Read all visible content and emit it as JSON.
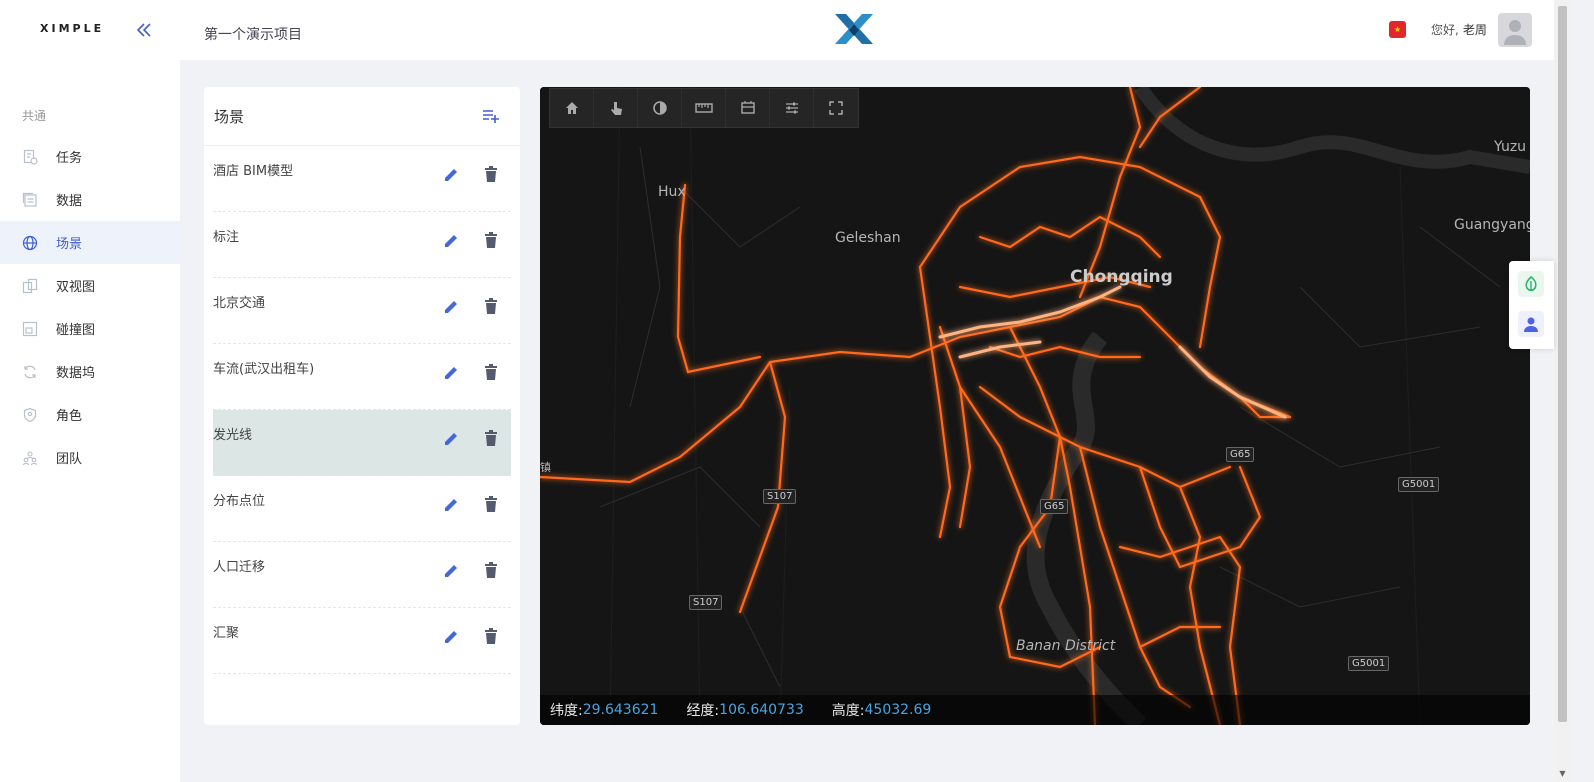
{
  "brand": "XIMPLE",
  "header": {
    "project_title": "第一个演示项目",
    "greeting": "您好,",
    "username": "老周",
    "flag_symbol": "★"
  },
  "sidebar": {
    "group_label": "共通",
    "items": [
      {
        "label": "任务",
        "icon": "task-icon",
        "active": false
      },
      {
        "label": "数据",
        "icon": "data-icon",
        "active": false
      },
      {
        "label": "场景",
        "icon": "globe-icon",
        "active": true
      },
      {
        "label": "双视图",
        "icon": "dual-view-icon",
        "active": false
      },
      {
        "label": "碰撞图",
        "icon": "collision-icon",
        "active": false
      },
      {
        "label": "数据坞",
        "icon": "refresh-icon",
        "active": false
      },
      {
        "label": "角色",
        "icon": "shield-icon",
        "active": false
      },
      {
        "label": "团队",
        "icon": "team-icon",
        "active": false
      }
    ]
  },
  "scene_panel": {
    "title": "场景",
    "rows": [
      {
        "name": "酒店 BIM模型",
        "active": false
      },
      {
        "name": "标注",
        "active": false
      },
      {
        "name": "北京交通",
        "active": false
      },
      {
        "name": "车流(武汉出租车)",
        "active": false
      },
      {
        "name": "发光线",
        "active": true
      },
      {
        "name": "分布点位",
        "active": false
      },
      {
        "name": "人口迁移",
        "active": false
      },
      {
        "name": "汇聚",
        "active": false
      }
    ]
  },
  "map": {
    "toolbar": [
      "home-icon",
      "touch-icon",
      "contrast-icon",
      "ruler-icon",
      "layers-icon",
      "sliders-icon",
      "fullscreen-icon"
    ],
    "labels": {
      "huxi": "Hux",
      "geleshan": "Geleshan",
      "chongqing": "Chongqing",
      "yuzui": "Yuzu",
      "guangyang": "Guangyang",
      "banan": "Banan District",
      "zhen": "镇"
    },
    "shields": {
      "s107a": "S107",
      "s107b": "S107",
      "g65a": "G65",
      "g65b": "G65",
      "g5001a": "G5001",
      "g5001b": "G5001"
    },
    "coords": {
      "lat_label": "纬度:",
      "lat_value": "29.643621",
      "lon_label": "经度:",
      "lon_value": "106.640733",
      "alt_label": "高度:",
      "alt_value": "45032.69"
    },
    "glow_color": "#ff6a1a"
  }
}
